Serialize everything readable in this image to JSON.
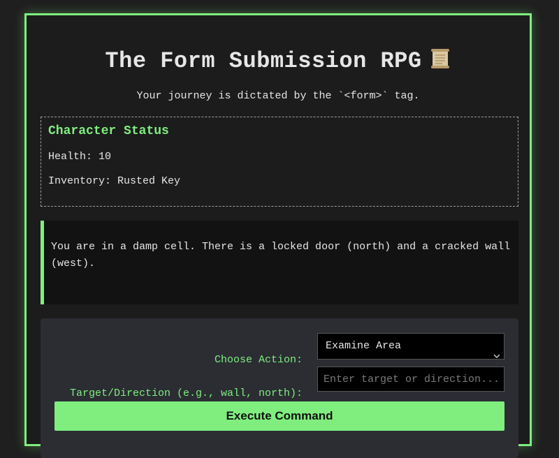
{
  "header": {
    "title": "The Form Submission RPG",
    "title_icon": "scroll-icon",
    "subtitle": "Your journey is dictated by the `<form>` tag."
  },
  "status": {
    "heading": "Character Status",
    "health": "Health: 10",
    "inventory": "Inventory: Rusted Key"
  },
  "narration": {
    "text": "You are in a damp cell. There is a locked door (north) and a cracked wall (west)."
  },
  "form": {
    "action_label": "Choose Action:",
    "action_selected": "Examine Area",
    "target_label": "Target/Direction (e.g., wall, north):",
    "target_value": "",
    "target_placeholder": "Enter target or direction...",
    "submit_label": "Execute Command"
  },
  "colors": {
    "accent": "#7fee7f",
    "background": "#1c1c1c",
    "panel": "#2b2d33",
    "text": "#e6e6e6"
  }
}
